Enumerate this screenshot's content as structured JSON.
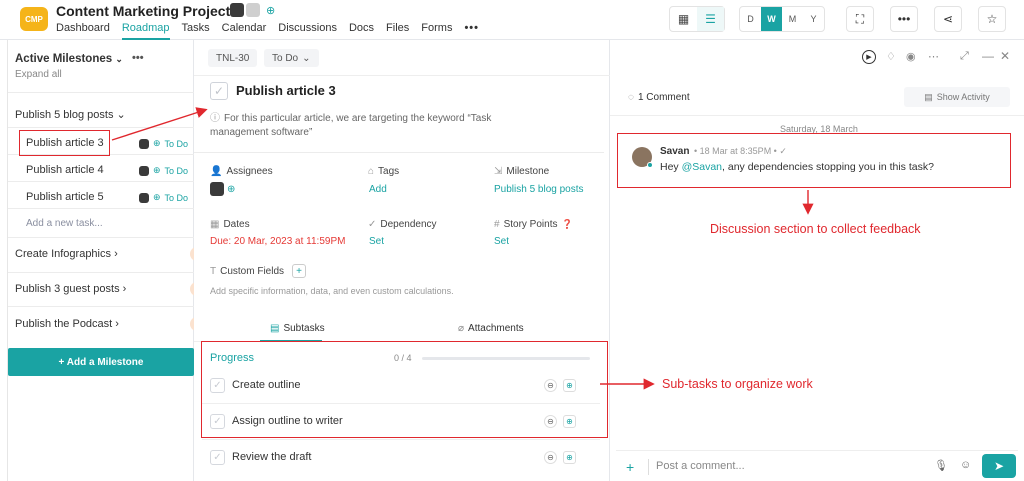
{
  "header": {
    "logo_text": "CMP",
    "project_title": "Content Marketing Project",
    "nav": [
      "Dashboard",
      "Roadmap",
      "Tasks",
      "Calendar",
      "Discussions",
      "Docs",
      "Files",
      "Forms"
    ],
    "active_nav": "Roadmap",
    "more_symbol": "•••",
    "calendar_views": [
      "D",
      "W",
      "M",
      "Y"
    ],
    "active_calendar_view": "W",
    "accent_color": "#1aa3a3"
  },
  "sidebar": {
    "heading": "Active Milestones",
    "expand_all": "Expand all",
    "groups": [
      {
        "label": "Publish 5 blog posts",
        "expanded": true
      },
      {
        "label": "Create Infographics",
        "expanded": false
      },
      {
        "label": "Publish 3 guest posts",
        "expanded": false
      },
      {
        "label": "Publish the Podcast",
        "expanded": false
      }
    ],
    "tasks": [
      {
        "label": "Publish article 3",
        "status": "To Do"
      },
      {
        "label": "Publish article 4",
        "status": "To Do"
      },
      {
        "label": "Publish article 5",
        "status": "To Do"
      }
    ],
    "add_task": "Add a new task...",
    "add_milestone": "+ Add a Milestone"
  },
  "task": {
    "id": "TNL-30",
    "status": "To Do",
    "title": "Publish article 3",
    "description": "For this particular article, we are targeting the keyword “Task management software”",
    "fields": {
      "assignees_label": "Assignees",
      "tags_label": "Tags",
      "tags_value": "Add",
      "milestone_label": "Milestone",
      "milestone_value": "Publish 5 blog posts",
      "dates_label": "Dates",
      "dates_value": "Due: 20 Mar, 2023 at 11:59PM",
      "dependency_label": "Dependency",
      "dependency_value": "Set",
      "story_points_label": "Story Points",
      "story_points_value": "Set"
    },
    "custom_fields_label": "Custom Fields",
    "custom_fields_desc": "Add specific information, data, and even custom calculations.",
    "tabs": [
      "Subtasks",
      "Attachments"
    ],
    "active_tab": "Subtasks",
    "progress_label": "Progress",
    "progress_count": "0 / 4",
    "progress_fraction": 0,
    "subtasks": [
      "Create outline",
      "Assign outline to writer",
      "Review the draft"
    ]
  },
  "comments": {
    "count_label": "1 Comment",
    "show_activity": "Show Activity",
    "date_divider": "Saturday, 18 March",
    "items": [
      {
        "author": "Savan",
        "time": "• 18 Mar at 8:35PM • ✓",
        "text_before": "Hey ",
        "mention": "@Savan",
        "text_after": ", any dependencies stopping you in this task?"
      }
    ],
    "composer_placeholder": "Post a comment..."
  },
  "annotations": {
    "discussion": "Discussion section to collect feedback",
    "subtasks": "Sub-tasks to organize work",
    "color": "#e0282e"
  }
}
